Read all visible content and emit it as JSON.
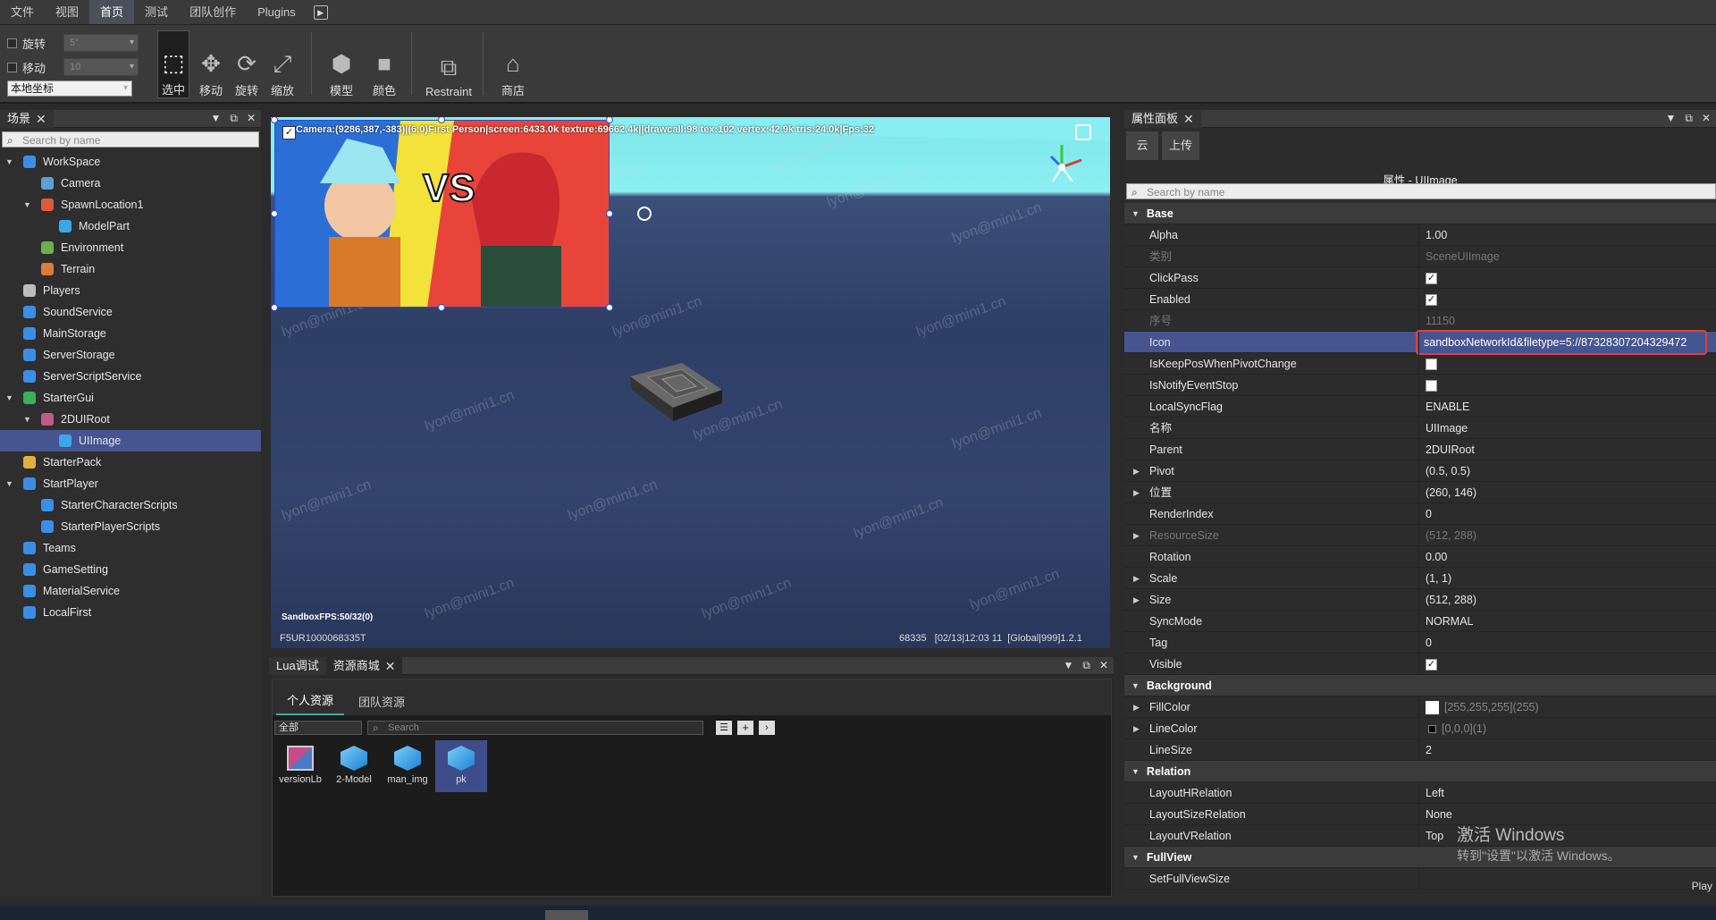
{
  "menu": {
    "items": [
      "文件",
      "视图",
      "首页",
      "测试",
      "团队创作",
      "Plugins"
    ],
    "active_index": 2
  },
  "toolbar": {
    "snap_rotate_label": "旋转",
    "snap_rotate_value": "5°",
    "snap_move_label": "移动",
    "snap_move_value": "10",
    "coord_mode": "本地坐标",
    "tools": {
      "select": "选中",
      "move": "移动",
      "rotate": "旋转",
      "scale": "缩放",
      "model": "模型",
      "color": "颜色",
      "restraint": "Restraint",
      "shop": "商店"
    }
  },
  "scene": {
    "tab_label": "场景",
    "search_placeholder": "Search by name",
    "tree": [
      {
        "label": "WorkSpace",
        "depth": 0,
        "expanded": true,
        "icon": "globe-icon",
        "color": "#3a8ee6"
      },
      {
        "label": "Camera",
        "depth": 1,
        "icon": "camera-icon",
        "color": "#5ca0d8"
      },
      {
        "label": "SpawnLocation1",
        "depth": 1,
        "expanded": true,
        "icon": "spawn-icon",
        "color": "#e05a3a"
      },
      {
        "label": "ModelPart",
        "depth": 2,
        "icon": "cube-icon",
        "color": "#3aa8e6"
      },
      {
        "label": "Environment",
        "depth": 1,
        "icon": "environment-icon",
        "color": "#6ab04c"
      },
      {
        "label": "Terrain",
        "depth": 1,
        "icon": "terrain-icon",
        "color": "#e07a3a"
      },
      {
        "label": "Players",
        "depth": 0,
        "icon": "players-icon",
        "color": "#bbbbbb"
      },
      {
        "label": "SoundService",
        "depth": 0,
        "icon": "sound-icon",
        "color": "#3a8ee6"
      },
      {
        "label": "MainStorage",
        "depth": 0,
        "icon": "storage-icon",
        "color": "#3a8ee6"
      },
      {
        "label": "ServerStorage",
        "depth": 0,
        "icon": "storage-icon",
        "color": "#3a8ee6"
      },
      {
        "label": "ServerScriptService",
        "depth": 0,
        "icon": "script-service-icon",
        "color": "#3a8ee6"
      },
      {
        "label": "StarterGui",
        "depth": 0,
        "expanded": true,
        "icon": "gui-icon",
        "color": "#3ab05a"
      },
      {
        "label": "2DUIRoot",
        "depth": 1,
        "expanded": true,
        "icon": "ui-root-icon",
        "color": "#c05a8a"
      },
      {
        "label": "UIImage",
        "depth": 2,
        "icon": "image-icon",
        "color": "#3aa8e6",
        "selected": true
      },
      {
        "label": "StarterPack",
        "depth": 0,
        "icon": "pack-icon",
        "color": "#e0b03a"
      },
      {
        "label": "StartPlayer",
        "depth": 0,
        "expanded": true,
        "icon": "player-icon",
        "color": "#3a8ee6"
      },
      {
        "label": "StarterCharacterScripts",
        "depth": 1,
        "icon": "script-icon",
        "color": "#3a8ee6"
      },
      {
        "label": "StarterPlayerScripts",
        "depth": 1,
        "icon": "script-icon",
        "color": "#3a8ee6"
      },
      {
        "label": "Teams",
        "depth": 0,
        "icon": "teams-icon",
        "color": "#3a8ee6"
      },
      {
        "label": "GameSetting",
        "depth": 0,
        "icon": "setting-icon",
        "color": "#3a8ee6"
      },
      {
        "label": "MaterialService",
        "depth": 0,
        "icon": "material-icon",
        "color": "#3a8ee6"
      },
      {
        "label": "LocalFirst",
        "depth": 0,
        "icon": "local-icon",
        "color": "#3a8ee6"
      }
    ]
  },
  "viewport": {
    "camera_info": "Camera:(9286,387,-383)|(6,0)First Person|screen:6433.0k texture:69662.4k||drawcall:98 tex:102 vertex:42.9k tris:24.0k|Fps:32",
    "watermark": "lyon@mini1.cn",
    "fps_label": "SandboxFPS:50/32(0)",
    "bottom_left": "F5UR1000068335T",
    "bottom_right": "68335   [02/13|12:03 11  [Global|999]1.2.1"
  },
  "bottom_panel": {
    "tabs": [
      "Lua调试",
      "资源商城"
    ],
    "subtabs": [
      "个人资源",
      "团队资源"
    ],
    "filter_value": "全部",
    "search_placeholder": "Search",
    "assets": [
      {
        "label": "versionLb",
        "icon": "ui-asset-icon"
      },
      {
        "label": "2-Model",
        "icon": "cube-asset-icon"
      },
      {
        "label": "man_img",
        "icon": "cube-asset-icon"
      },
      {
        "label": "pk",
        "icon": "cube-asset-icon",
        "selected": true
      }
    ]
  },
  "props": {
    "tab_label": "属性面板",
    "btn_cloud": "云",
    "btn_upload": "上传",
    "title": "属性 - UIImage",
    "search_placeholder": "Search by name",
    "rows": [
      {
        "type": "group",
        "name": "Base"
      },
      {
        "name": "Alpha",
        "value": "1.00"
      },
      {
        "name": "类别",
        "value": "SceneUIImage",
        "dim": true
      },
      {
        "name": "ClickPass",
        "check": true
      },
      {
        "name": "Enabled",
        "check": true
      },
      {
        "name": "序号",
        "value": "11150",
        "dim": true
      },
      {
        "name": "Icon",
        "value": "sandboxNetworkId&filetype=5://87328307204329472",
        "selected": true,
        "highlight": true
      },
      {
        "name": "IsKeepPosWhenPivotChange",
        "check": false
      },
      {
        "name": "IsNotifyEventStop",
        "check": false
      },
      {
        "name": "LocalSyncFlag",
        "value": "ENABLE"
      },
      {
        "name": "名称",
        "value": "UIImage"
      },
      {
        "name": "Parent",
        "value": "2DUIRoot"
      },
      {
        "name": "Pivot",
        "value": "(0.5, 0.5)",
        "expandable": true
      },
      {
        "name": "位置",
        "value": "(260, 146)",
        "expandable": true
      },
      {
        "name": "RenderIndex",
        "value": "0"
      },
      {
        "name": "ResourceSize",
        "value": "(512, 288)",
        "expandable": true,
        "dim": true
      },
      {
        "name": "Rotation",
        "value": "0.00"
      },
      {
        "name": "Scale",
        "value": "(1, 1)",
        "expandable": true
      },
      {
        "name": "Size",
        "value": "(512, 288)",
        "expandable": true
      },
      {
        "name": "SyncMode",
        "value": "NORMAL"
      },
      {
        "name": "Tag",
        "value": "0"
      },
      {
        "name": "Visible",
        "check": true
      },
      {
        "type": "group",
        "name": "Background"
      },
      {
        "name": "FillColor",
        "value": "[255,255,255](255)",
        "expandable": true,
        "swatch": "#ffffff"
      },
      {
        "name": "LineColor",
        "value": "[0,0,0](1)",
        "expandable": true,
        "swatch": "#000000"
      },
      {
        "name": "LineSize",
        "value": "2"
      },
      {
        "type": "group",
        "name": "Relation"
      },
      {
        "name": "LayoutHRelation",
        "value": "Left"
      },
      {
        "name": "LayoutSizeRelation",
        "value": "None"
      },
      {
        "name": "LayoutVRelation",
        "value": "Top"
      },
      {
        "type": "group",
        "name": "FullView"
      },
      {
        "name": "SetFullViewSize",
        "value": ""
      }
    ],
    "play_label": "Play"
  },
  "activation": {
    "title": "激活 Windows",
    "subtitle": "转到\"设置\"以激活 Windows。"
  },
  "colors": {
    "selection": "#465590",
    "highlight_border": "#e0403a",
    "sky": "#8ceff2"
  }
}
